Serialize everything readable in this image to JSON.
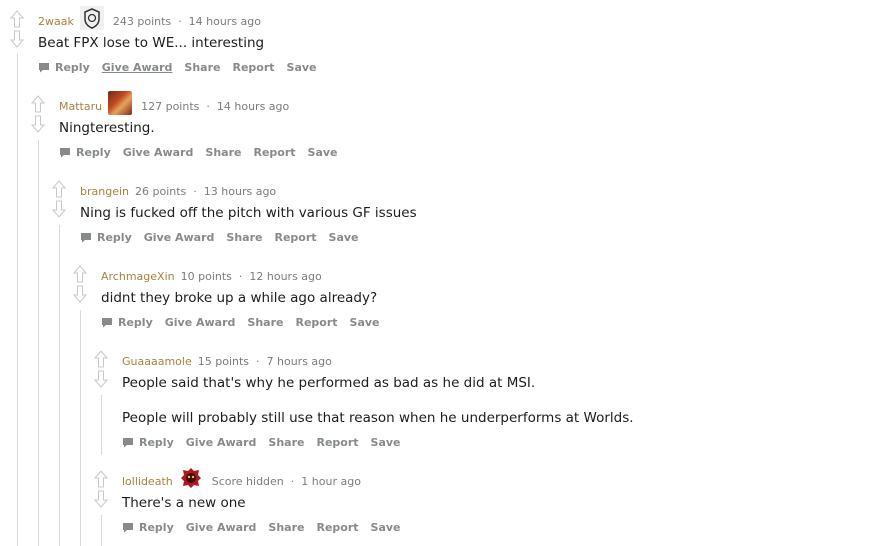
{
  "comments": [
    {
      "author": "2waak",
      "flair_icon": "g2-esports-logo-icon",
      "points": "243 points",
      "time": "14 hours ago",
      "body": [
        "Beat FPX lose to WE... interesting"
      ],
      "actions": [
        "Reply",
        "Give Award",
        "Share",
        "Report",
        "Save"
      ]
    },
    {
      "author": "Mattaru",
      "flair_icon": "champion-portrait-icon",
      "points": "127 points",
      "time": "14 hours ago",
      "body": [
        "Ningteresting."
      ],
      "actions": [
        "Reply",
        "Give Award",
        "Share",
        "Report",
        "Save"
      ]
    },
    {
      "author": "brangein",
      "points": "26 points",
      "time": "13 hours ago",
      "body": [
        "Ning is fucked off the pitch with various GF issues"
      ],
      "actions": [
        "Reply",
        "Give Award",
        "Share",
        "Report",
        "Save"
      ]
    },
    {
      "author": "ArchmageXin",
      "points": "10 points",
      "time": "12 hours ago",
      "body": [
        "didnt they broke up a while ago already?"
      ],
      "actions": [
        "Reply",
        "Give Award",
        "Share",
        "Report",
        "Save"
      ]
    },
    {
      "author": "Guaaaamole",
      "points": "15 points",
      "time": "7 hours ago",
      "body": [
        "People said that's why he performed as bad as he did at MSI.",
        "People will probably still use that reason when he underperforms at Worlds."
      ],
      "actions": [
        "Reply",
        "Give Award",
        "Share",
        "Report",
        "Save"
      ]
    },
    {
      "author": "lollideath",
      "flair_icon": "red-team-logo-icon",
      "points": "Score hidden",
      "time": "1 hour ago",
      "body": [
        "There's a new one"
      ],
      "actions": [
        "Reply",
        "Give Award",
        "Share",
        "Report",
        "Save"
      ]
    }
  ],
  "colors": {
    "author": "#a5823f",
    "meta": "#7c7c7c",
    "action": "#878a8c",
    "thread_line": "#dadada"
  }
}
